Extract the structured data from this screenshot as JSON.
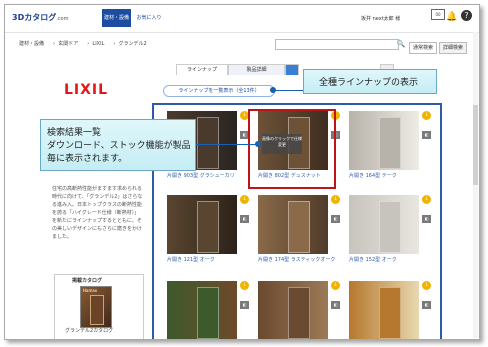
{
  "header": {
    "logo_main": "3Dカタログ",
    "logo_suffix": ".com",
    "nav": [
      "建材・設備",
      "お気に入り"
    ],
    "user_name": "坂井 next太郎 様",
    "bell_badge": "00",
    "help_icon": "?"
  },
  "breadcrumb": [
    "建材・設備",
    "玄関ドア",
    "LIXIL",
    "グランデル2"
  ],
  "search": {
    "placeholder": "",
    "modes": [
      "通常検索",
      "詳細検索"
    ]
  },
  "brand": {
    "logo": "LIXIL"
  },
  "tabs": [
    "ラインナップ",
    "製品詳細",
    "",
    ""
  ],
  "lineup_button": "ラインナップを一覧表示（全13件）",
  "description": "住宅の高断熱性能がますます求められる時代に向けて、「グランデル2」はさらなる進み入。日本トップクラスの断熱性能を誇る「ハイグレード仕様（断熱材）」を新たにラインナップするとともに、その美しいデザインにもさらに磨きをかけました。",
  "catalog": {
    "title": "掲載カタログ",
    "name": "グランデル2カタログ",
    "cover_brand": "Hamax"
  },
  "callouts": {
    "lineup": "全種ラインナップの表示",
    "results_title": "検索結果一覧",
    "results_body": "ダウンロード、ストック機能が製品毎に表示されます。"
  },
  "products": [
    {
      "caption": "片開き 903型 グラシューカリ",
      "colors": [
        "#4a3a2e",
        "#2a2522"
      ]
    },
    {
      "caption": "片開き 802型 デュスナット",
      "colors": [
        "#6d5238",
        "#3e2d20"
      ]
    },
    {
      "caption": "片開き 164型 テーク",
      "colors": [
        "#b7b2aa",
        "#efece6"
      ]
    },
    {
      "caption": "片開き 121型 オーク",
      "colors": [
        "#5a4630",
        "#2c2219"
      ]
    },
    {
      "caption": "片開き 174型 ラスティックオーク",
      "colors": [
        "#8a6a48",
        "#4f3b2a"
      ]
    },
    {
      "caption": "片開き 152型 オーク",
      "colors": [
        "#c7c4bd",
        "#e9e6df"
      ]
    },
    {
      "caption": "",
      "colors": [
        "#3d5a2c",
        "#6e4a2a"
      ]
    },
    {
      "caption": "",
      "colors": [
        "#6a4a30",
        "#9c7a56"
      ]
    },
    {
      "caption": "",
      "colors": [
        "#b6782e",
        "#e8d8b0"
      ]
    }
  ],
  "hover_overlay": "画像のクリックで仕様変更",
  "icons": {
    "download": "download-icon",
    "stock": "stock-icon"
  }
}
